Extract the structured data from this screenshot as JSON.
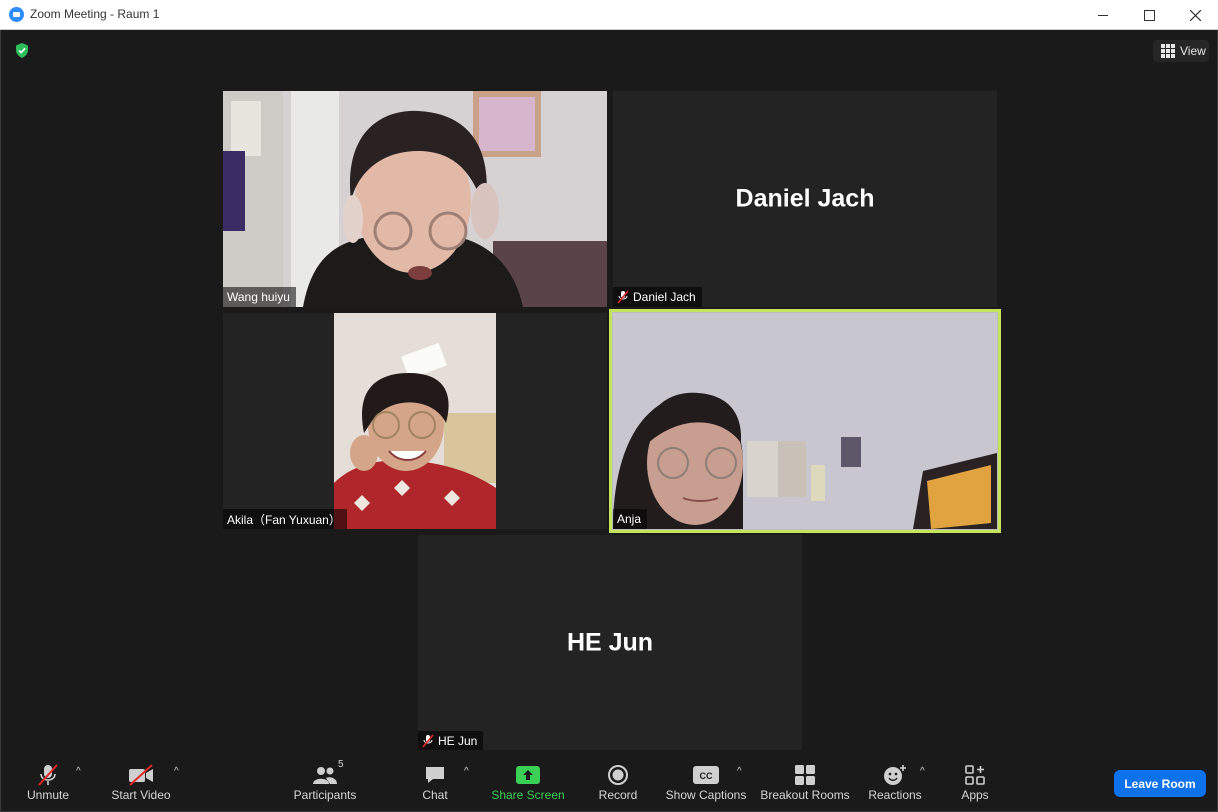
{
  "window": {
    "title": "Zoom Meeting - Raum 1"
  },
  "header": {
    "view_label": "View",
    "shield": "security-shield-icon"
  },
  "participants_grid": [
    {
      "name": "Wang huiyu",
      "muted": false,
      "video": true
    },
    {
      "name": "Daniel Jach",
      "display_name": "Daniel Jach",
      "muted": true,
      "video": false
    },
    {
      "name": "Akila（Fan Yuxuan）",
      "muted": false,
      "video": true
    },
    {
      "name": "Anja",
      "muted": false,
      "video": true,
      "active_speaker": true
    },
    {
      "name": "HE Jun",
      "display_name": "HE Jun",
      "muted": true,
      "video": false
    }
  ],
  "toolbar": {
    "unmute": "Unmute",
    "start_video": "Start Video",
    "participants": "Participants",
    "participants_count": "5",
    "chat": "Chat",
    "share_screen": "Share Screen",
    "record": "Record",
    "show_captions": "Show Captions",
    "breakout_rooms": "Breakout Rooms",
    "reactions": "Reactions",
    "apps": "Apps",
    "leave_room": "Leave Room",
    "cc_text": "CC"
  },
  "colors": {
    "active_speaker": "#c4e55b",
    "share_green": "#3ad056",
    "leave_blue": "#0e72ed",
    "mute_red": "#e02828"
  }
}
